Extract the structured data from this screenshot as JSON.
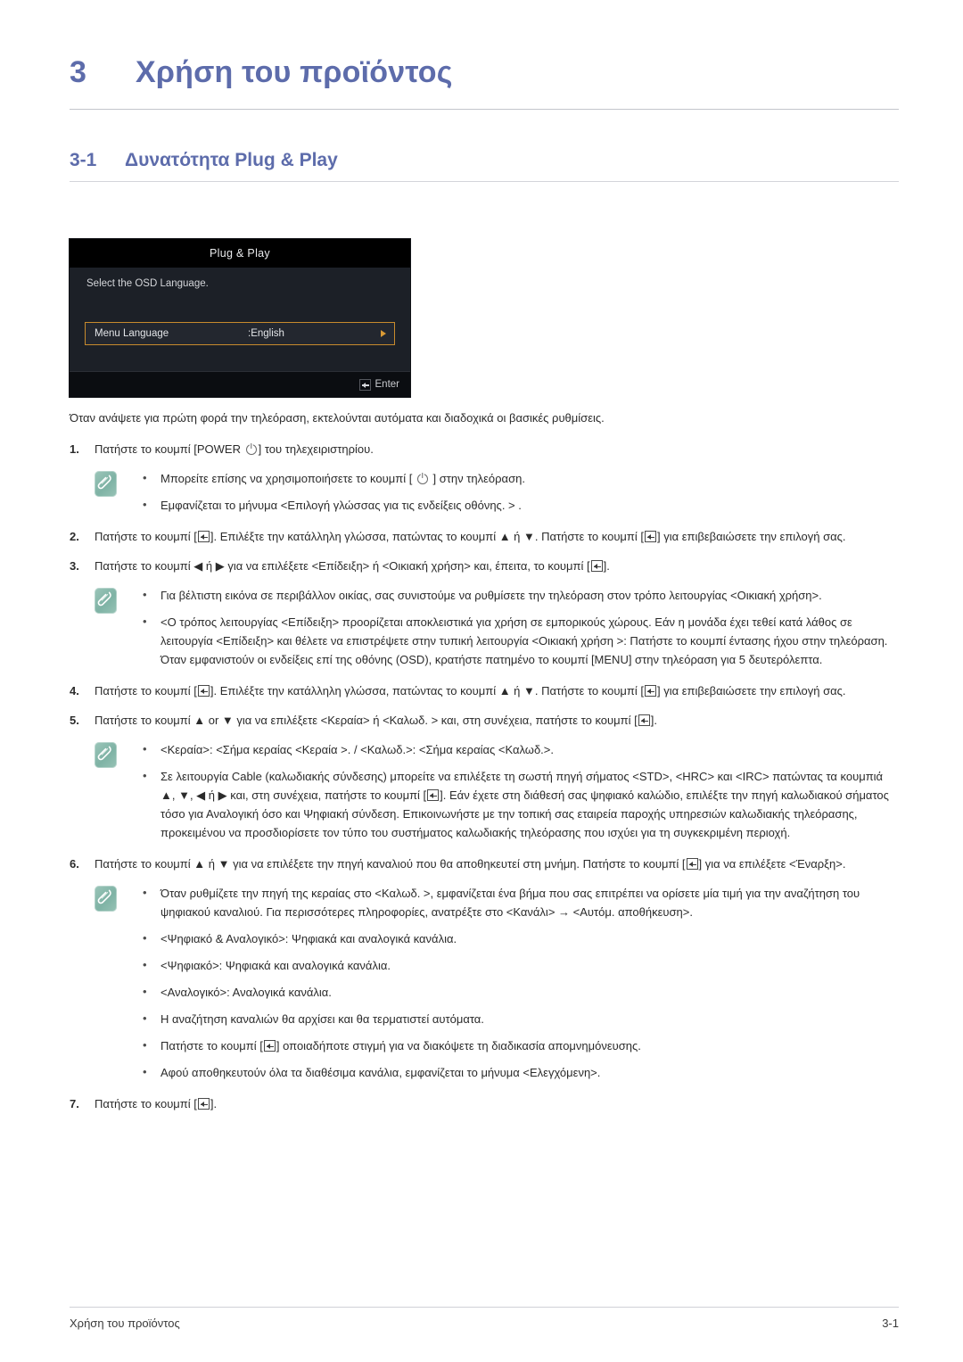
{
  "chapter": {
    "number": "3",
    "title": "Χρήση του προϊόντος"
  },
  "section": {
    "number": "3-1",
    "title": "Δυνατότητα Plug & Play"
  },
  "osd": {
    "title": "Plug & Play",
    "prompt": "Select the OSD Language.",
    "row_label": "Menu Language",
    "row_value": ":English",
    "enter_label": "Enter",
    "highlight_color": "#c78a2d",
    "arrow_icon": "triangle-right-icon",
    "enter_icon": "enter-key-icon"
  },
  "intro": "Όταν ανάψετε για πρώτη φορά την τηλεόραση, εκτελούνται αυτόματα και διαδοχικά οι βασικές ρυθμίσεις.",
  "steps": [
    {
      "number": "1.",
      "parts": [
        {
          "t": "text",
          "v": "Πατήστε το κουμπί [POWER "
        },
        {
          "t": "icon",
          "v": "power-icon"
        },
        {
          "t": "text",
          "v": "] του τηλεχειριστηρίου."
        }
      ]
    },
    {
      "number": "2.",
      "parts": [
        {
          "t": "text",
          "v": "Πατήστε το κουμπί ["
        },
        {
          "t": "icon",
          "v": "enter-key-icon"
        },
        {
          "t": "text",
          "v": "]. Επιλέξτε την κατάλληλη γλώσσα, πατώντας το κουμπί ▲ ή ▼. Πατήστε το κουμπί ["
        },
        {
          "t": "icon",
          "v": "enter-key-icon"
        },
        {
          "t": "text",
          "v": "] για επιβεβαιώσετε την επιλογή σας."
        }
      ]
    },
    {
      "number": "3.",
      "parts": [
        {
          "t": "text",
          "v": "Πατήστε το κουμπί ◀ ή ▶ για να επιλέξετε <Επίδειξη> ή <Οικιακή χρήση> και, έπειτα, το κουμπί ["
        },
        {
          "t": "icon",
          "v": "enter-key-icon"
        },
        {
          "t": "text",
          "v": "]."
        }
      ]
    },
    {
      "number": "4.",
      "parts": [
        {
          "t": "text",
          "v": "Πατήστε το κουμπί ["
        },
        {
          "t": "icon",
          "v": "enter-key-icon"
        },
        {
          "t": "text",
          "v": "]. Επιλέξτε την κατάλληλη γλώσσα, πατώντας το κουμπί ▲ ή ▼. Πατήστε το κουμπί ["
        },
        {
          "t": "icon",
          "v": "enter-key-icon"
        },
        {
          "t": "text",
          "v": "] για επιβεβαιώσετε την επιλογή σας."
        }
      ]
    },
    {
      "number": "5.",
      "parts": [
        {
          "t": "text",
          "v": "Πατήστε το κουμπί ▲ or ▼ για να επιλέξετε <Κεραία> ή <Καλωδ. > και, στη συνέχεια, πατήστε το κουμπί ["
        },
        {
          "t": "icon",
          "v": "enter-key-icon"
        },
        {
          "t": "text",
          "v": "]."
        }
      ]
    },
    {
      "number": "6.",
      "parts": [
        {
          "t": "text",
          "v": "Πατήστε το κουμπί ▲ ή ▼ για να επιλέξετε την πηγή καναλιού που θα αποθηκευτεί στη μνήμη. Πατήστε το κουμπί ["
        },
        {
          "t": "icon",
          "v": "enter-key-icon"
        },
        {
          "t": "text",
          "v": "] για να επιλέξετε <Έναρξη>."
        }
      ]
    },
    {
      "number": "7.",
      "parts": [
        {
          "t": "text",
          "v": "Πατήστε το κουμπί ["
        },
        {
          "t": "icon",
          "v": "enter-key-icon"
        },
        {
          "t": "text",
          "v": "]."
        }
      ]
    }
  ],
  "notes": [
    {
      "after_step": "1",
      "icon": "note-pencil-icon",
      "items": [
        [
          {
            "t": "text",
            "v": "Μπορείτε επίσης να χρησιμοποιήσετε το κουμπί [ "
          },
          {
            "t": "icon",
            "v": "power-icon"
          },
          {
            "t": "text",
            "v": " ] στην τηλεόραση."
          }
        ],
        [
          {
            "t": "text",
            "v": "Εμφανίζεται το μήνυμα <Επιλογή γλώσσας για τις ενδείξεις οθόνης. > ."
          }
        ]
      ]
    },
    {
      "after_step": "3",
      "icon": "note-pencil-icon",
      "items": [
        [
          {
            "t": "text",
            "v": "Για βέλτιστη εικόνα σε περιβάλλον οικίας, σας συνιστούμε να ρυθμίσετε την τηλεόραση στον τρόπο λειτουργίας <Οικιακή χρήση>."
          }
        ],
        [
          {
            "t": "text",
            "v": "<Ο τρόπος λειτουργίας <Επίδειξη> προορίζεται αποκλειστικά για χρήση σε εμπορικούς χώρους. Εάν η μονάδα έχει τεθεί κατά λάθος σε λειτουργία <Επίδειξη> και θέλετε να επιστρέψετε στην τυπική λειτουργία <Οικιακή χρήση >: Πατήστε το κουμπί έντασης ήχου στην τηλεόραση. Όταν εμφανιστούν οι ενδείξεις επί της οθόνης (OSD), κρατήστε πατημένο το κουμπί [MENU] στην τηλεόραση για 5 δευτερόλεπτα."
          }
        ]
      ]
    },
    {
      "after_step": "5",
      "icon": "note-pencil-icon",
      "items": [
        [
          {
            "t": "text",
            "v": "<Κεραία>: <Σήμα κεραίας <Κεραία >. / <Καλωδ.>: <Σήμα κεραίας <Καλωδ.>."
          }
        ],
        [
          {
            "t": "text",
            "v": "Σε λειτουργία Cable (καλωδιακής σύνδεσης) μπορείτε να επιλέξετε τη σωστή πηγή σήματος <STD>, <HRC> και <IRC> πατώντας τα κουμπιά ▲, ▼, ◀ ή ▶ και, στη συνέχεια, πατήστε το κουμπί ["
          },
          {
            "t": "icon",
            "v": "enter-key-icon"
          },
          {
            "t": "text",
            "v": "]. Εάν έχετε στη διάθεσή σας ψηφιακό καλώδιο, επιλέξτε την πηγή καλωδιακού σήματος τόσο για Αναλογική όσο και Ψηφιακή σύνδεση. Επικοινωνήστε με την τοπική σας εταιρεία παροχής υπηρεσιών καλωδιακής τηλεόρασης, προκειμένου να προσδιορίσετε τον τύπο του συστήματος καλωδιακής τηλεόρασης που ισχύει για τη συγκεκριμένη περιοχή."
          }
        ]
      ]
    },
    {
      "after_step": "6",
      "icon": "note-pencil-icon",
      "items": [
        [
          {
            "t": "text",
            "v": "Όταν ρυθμίζετε την πηγή της κεραίας στο <Καλωδ. >, εμφανίζεται ένα βήμα που σας επιτρέπει να ορίσετε μία τιμή για την αναζήτηση του ψηφιακού καναλιού. Για περισσότερες πληροφορίες, ανατρέξτε στο <Κανάλι> → <Αυτόμ. αποθήκευση>."
          }
        ],
        [
          {
            "t": "text",
            "v": "<Ψηφιακό & Αναλογικό>: Ψηφιακά και αναλογικά κανάλια."
          }
        ],
        [
          {
            "t": "text",
            "v": "<Ψηφιακό>: Ψηφιακά και αναλογικά κανάλια."
          }
        ],
        [
          {
            "t": "text",
            "v": "<Αναλογικό>: Αναλογικά κανάλια."
          }
        ],
        [
          {
            "t": "text",
            "v": "Η αναζήτηση καναλιών θα αρχίσει και θα τερματιστεί αυτόματα."
          }
        ],
        [
          {
            "t": "text",
            "v": "Πατήστε το κουμπί ["
          },
          {
            "t": "icon",
            "v": "enter-key-icon"
          },
          {
            "t": "text",
            "v": "] οποιαδήποτε στιγμή για να διακόψετε τη διαδικασία απομνημόνευσης."
          }
        ],
        [
          {
            "t": "text",
            "v": "Αφού αποθηκευτούν όλα τα διαθέσιμα κανάλια, εμφανίζεται το μήνυμα <Ελεγχόμενη>."
          }
        ]
      ]
    }
  ],
  "footer": {
    "left": "Χρήση του προϊόντος",
    "right": "3-1"
  },
  "colors": {
    "heading": "#5d6cab",
    "body_text": "#2b2b2b",
    "note_badge": "#7fb3a5",
    "osd_highlight": "#c78a2d"
  }
}
